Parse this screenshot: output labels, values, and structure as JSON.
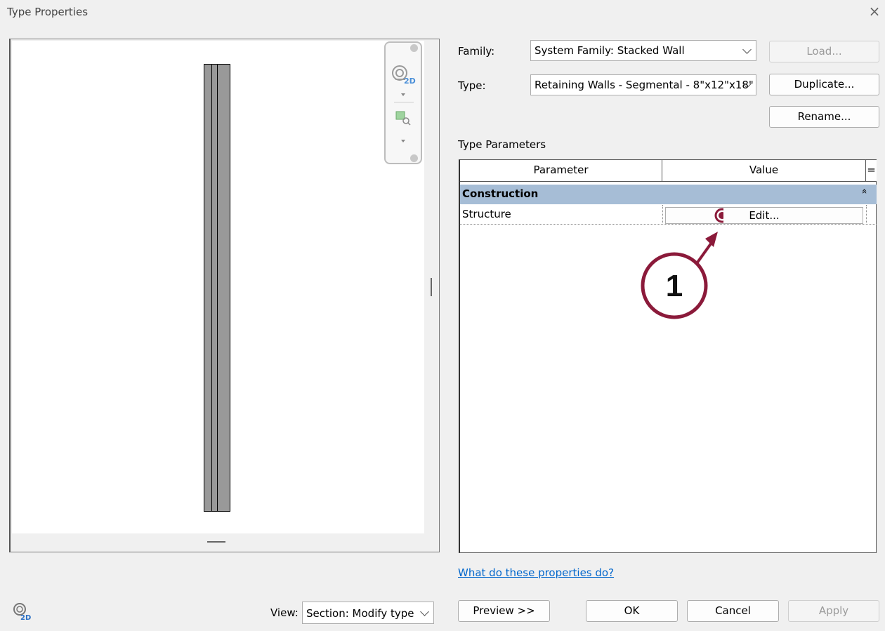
{
  "dialog": {
    "title": "Type Properties",
    "close_glyph": "×"
  },
  "preview_nav": {
    "zoom_label": "2D"
  },
  "family": {
    "label": "Family:",
    "value": "System Family: Stacked Wall"
  },
  "type": {
    "label": "Type:",
    "value": "Retaining Walls - Segmental - 8\"x12\"x18\""
  },
  "buttons": {
    "load": "Load...",
    "duplicate": "Duplicate...",
    "rename": "Rename...",
    "preview": "Preview >>",
    "ok": "OK",
    "cancel": "Cancel",
    "apply": "Apply"
  },
  "params": {
    "section_title": "Type Parameters",
    "col_parameter": "Parameter",
    "col_value": "Value",
    "col_eq": "=",
    "group": "Construction",
    "group_glyph": "»",
    "rows": [
      {
        "name": "Structure",
        "value": "Edit..."
      }
    ]
  },
  "help_link": "What do these properties do?",
  "view": {
    "label": "View:",
    "value": "Section: Modify type"
  },
  "callout": {
    "number": "1",
    "color": "#8b1a3a"
  },
  "icons": {
    "view_cube": "2d-zoom-icon",
    "zoom_region": "zoom-region-icon"
  }
}
